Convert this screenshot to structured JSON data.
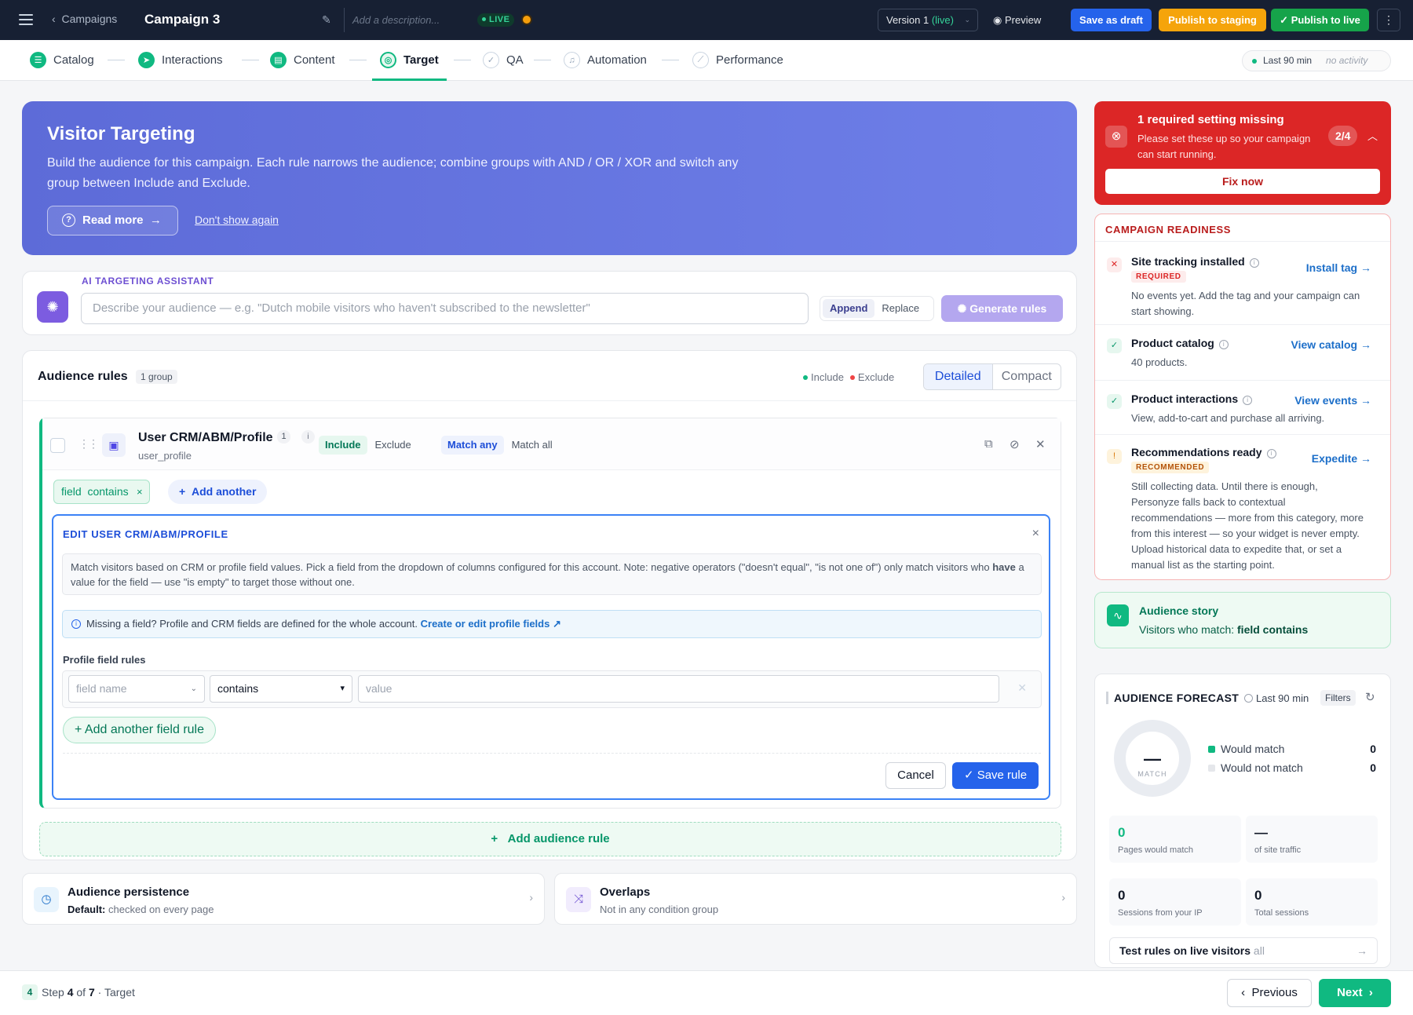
{
  "topbar": {
    "back_label": "Campaigns",
    "campaign_title": "Campaign 3",
    "description_placeholder": "Add a description...",
    "live_badge": "LIVE",
    "version_prefix": "Version 1",
    "version_status": "(live)",
    "preview_label": "Preview",
    "save_draft_label": "Save as draft",
    "publish_staging_label": "Publish to staging",
    "publish_live_label": "Publish to live",
    "menu_glyph": "⋮"
  },
  "steps": [
    {
      "label": "Catalog",
      "state": "done"
    },
    {
      "label": "Interactions",
      "state": "done"
    },
    {
      "label": "Content",
      "state": "done"
    },
    {
      "label": "Target",
      "state": "current"
    },
    {
      "label": "QA",
      "state": "todo"
    },
    {
      "label": "Automation",
      "state": "todo"
    },
    {
      "label": "Performance",
      "state": "todo"
    }
  ],
  "activity": {
    "range": "Last 90 min",
    "status": "no activity"
  },
  "hero": {
    "title": "Visitor Targeting",
    "body": "Build the audience for this campaign. Each rule narrows the audience; combine groups with AND / OR / XOR and switch any group between Include and Exclude.",
    "read_more": "Read more",
    "dont_show": "Don't show again"
  },
  "ai": {
    "label": "AI TARGETING ASSISTANT",
    "placeholder": "Describe your audience — e.g. \"Dutch mobile visitors who haven't subscribed to the newsletter\"",
    "append": "Append",
    "replace": "Replace",
    "generate": "Generate rules"
  },
  "rules": {
    "title": "Audience rules",
    "group_count": "1 group",
    "legend_include": "Include",
    "legend_exclude": "Exclude",
    "view_detailed": "Detailed",
    "view_compact": "Compact",
    "group": {
      "title": "User CRM/ABM/Profile",
      "count": "1",
      "info": "i",
      "subtitle": "user_profile",
      "include": "Include",
      "exclude": "Exclude",
      "match_any": "Match any",
      "match_all": "Match all"
    },
    "chip": {
      "field": "field",
      "op": "contains"
    },
    "add_another": "Add another",
    "editor": {
      "title": "EDIT USER CRM/ABM/PROFILE",
      "desc_a": "Match visitors based on CRM or profile field values. Pick a field from the dropdown of columns configured for this account. Note: negative operators (\"doesn't equal\", \"is not one of\") only match visitors who ",
      "desc_b": "have",
      "desc_c": " a value for the field — use \"is empty\" to target those without one.",
      "note_text": "Missing a field? Profile and CRM fields are defined for the whole account. ",
      "note_link": "Create or edit profile fields",
      "rules_label": "Profile field rules",
      "field_placeholder": "field name",
      "operator": "contains",
      "value_placeholder": "value",
      "add_field_rule": "+ Add another field rule",
      "cancel": "Cancel",
      "save": "Save rule"
    },
    "add_audience_rule": "Add audience rule"
  },
  "persistence": {
    "title": "Audience persistence",
    "default_label": "Default:",
    "default_value": "checked on every page"
  },
  "overlaps": {
    "title": "Overlaps",
    "subtitle": "Not in any condition group"
  },
  "alert": {
    "title": "1 required setting missing",
    "subtitle": "Please set these up so your campaign can start running.",
    "count": "2/4",
    "fix": "Fix now"
  },
  "readiness": {
    "title": "CAMPAIGN READINESS",
    "items": [
      {
        "title": "Site tracking installed",
        "badge": "REQUIRED",
        "link": "Install tag →",
        "desc": "No events yet. Add the tag and your campaign can start showing."
      },
      {
        "title": "Product catalog",
        "link": "View catalog →",
        "desc": "40 products."
      },
      {
        "title": "Product interactions",
        "link": "View events →",
        "desc": "View, add-to-cart and purchase all arriving."
      },
      {
        "title": "Recommendations ready",
        "badge": "RECOMMENDED",
        "link": "Expedite →",
        "desc": "Still collecting data. Until there is enough, Personyze falls back to contextual recommendations — more from this category, more from this interest — so your widget is never empty. Upload historical data to expedite that, or set a manual list as the starting point."
      }
    ]
  },
  "story": {
    "title": "Audience story",
    "prefix": "Visitors who match: ",
    "match": "field contains"
  },
  "forecast": {
    "title": "AUDIENCE FORECAST",
    "range": "Last 90 min",
    "filters": "Filters",
    "donut_value": "—",
    "donut_label": "MATCH",
    "would_match": "Would match",
    "would_match_value": "0",
    "would_not_match": "Would not match",
    "would_not_match_value": "0",
    "stats": [
      {
        "value": "0",
        "label": "Pages would match"
      },
      {
        "value": "—",
        "label": "of site traffic"
      },
      {
        "value": "0",
        "label": "Sessions from your IP"
      },
      {
        "value": "0",
        "label": "Total sessions"
      }
    ],
    "test_label": "Test rules on live visitors",
    "test_scope": "all"
  },
  "footer": {
    "step_num": "4",
    "step_word": "Step",
    "step_current": "4",
    "of": "of",
    "step_total": "7",
    "step_name": "· Target",
    "previous": "Previous",
    "next": "Next"
  },
  "colors": {
    "accent": "#10b981",
    "primary": "#2563eb",
    "danger": "#dc2626",
    "warning": "#f5a40b",
    "ai": "#7c5ce0"
  }
}
